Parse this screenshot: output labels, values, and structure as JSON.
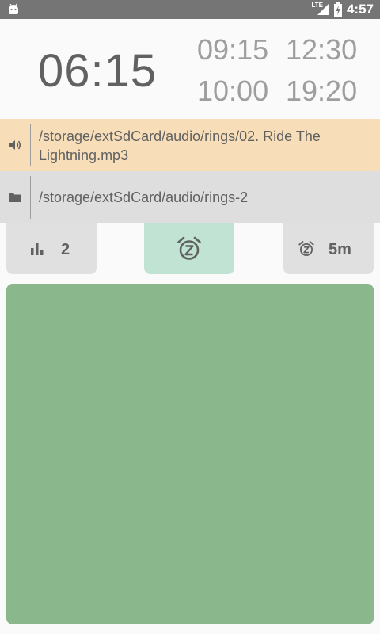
{
  "status_bar": {
    "time": "4:57",
    "network": "LTE"
  },
  "clock": {
    "current": "06:15",
    "alarms": [
      "09:15",
      "12:30",
      "10:00",
      "19:20"
    ]
  },
  "sound": {
    "icon": "volume-icon",
    "path": "/storage/extSdCard/audio/rings/02. Ride The Lightning.mp3"
  },
  "folder": {
    "icon": "folder-icon",
    "path": "/storage/extSdCard/audio/rings-2"
  },
  "buttons": {
    "count": {
      "icon": "bar-chart-icon",
      "label": "2"
    },
    "snooze": {
      "icon": "snooze-alarm-icon"
    },
    "duration": {
      "icon": "snooze-alarm-icon",
      "label": "5m"
    }
  },
  "colors": {
    "sound_row": "#f8deb8",
    "snooze_active": "#c0e3d4",
    "panel": "#8ab78b"
  }
}
